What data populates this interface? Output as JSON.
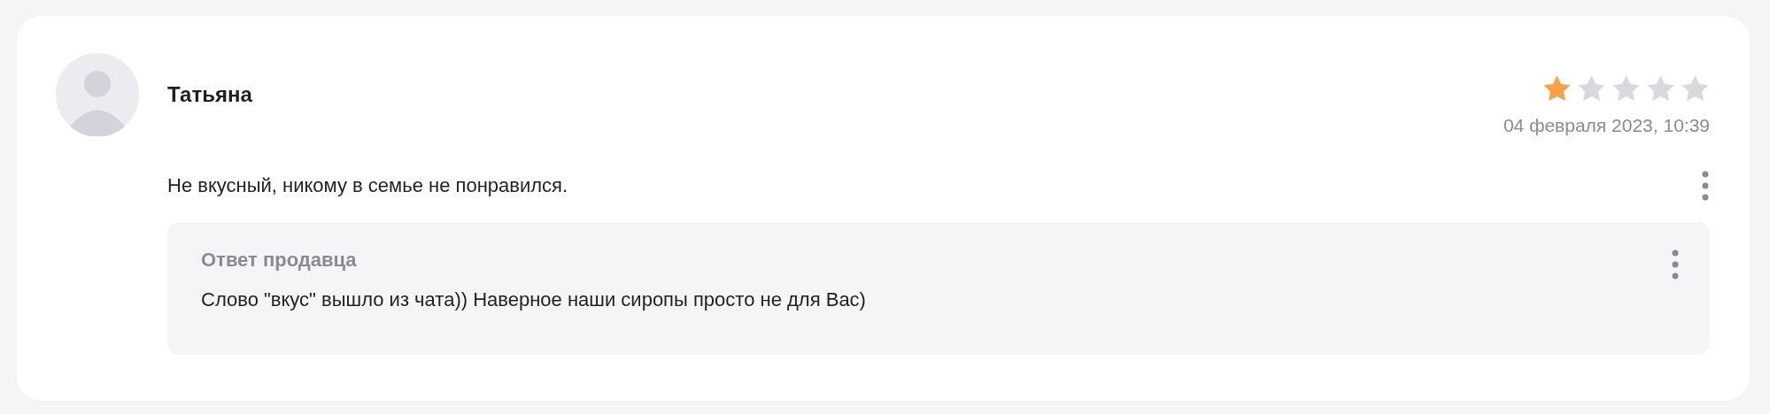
{
  "review": {
    "author": "Татьяна",
    "stars": 1,
    "date": "04 февраля 2023, 10:39",
    "text": "Не вкусный, никому в семье не понравился.",
    "seller_reply": {
      "title": "Ответ продавца",
      "text": "Слово \"вкус\" вышло из чата)) Наверное наши сиропы просто не для Вас)"
    }
  }
}
